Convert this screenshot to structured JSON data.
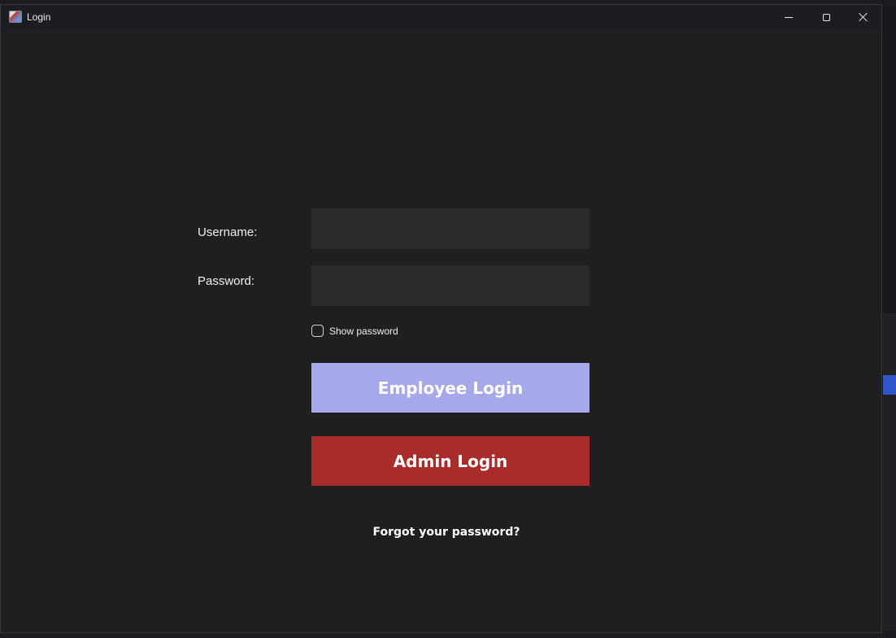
{
  "window": {
    "title": "Login",
    "icon": "java-app-icon",
    "controls": {
      "minimize": "minimize-icon",
      "maximize": "maximize-icon",
      "close": "close-icon"
    }
  },
  "form": {
    "username_label": "Username:",
    "username_value": "",
    "password_label": "Password:",
    "password_value": "",
    "show_password_label": "Show password",
    "show_password_checked": false
  },
  "buttons": {
    "employee_login": "Employee Login",
    "admin_login": "Admin Login"
  },
  "links": {
    "forgot_password": "Forgot your password?"
  },
  "colors": {
    "window_bg": "#1f1f1f",
    "field_bg": "#2b2b2b",
    "employee_button": "#a7a8ea",
    "admin_button": "#a82d2a",
    "text": "#ffffff"
  }
}
